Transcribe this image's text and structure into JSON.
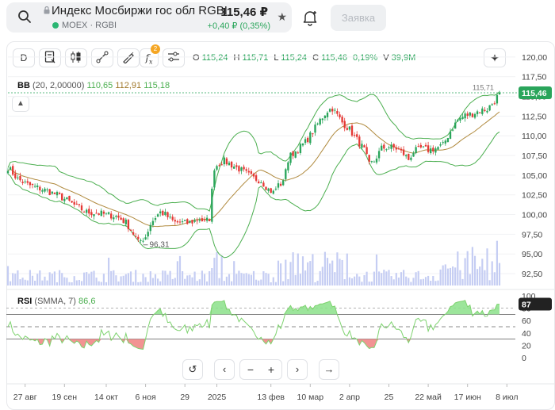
{
  "header": {
    "title": "Индекс Мосбиржи гос обл RGBI",
    "exchange": "MOEX · RGBI",
    "price": "115,46 ₽",
    "change": "+0,40 ₽ (0,35%)"
  },
  "order_button": "Заявка",
  "toolbar": {
    "period": "D",
    "fx_badge": "2"
  },
  "ohlc": {
    "o_label": "O",
    "o": "115,24",
    "h_label": "H",
    "h": "115,71",
    "l_label": "L",
    "l": "115,24",
    "c_label": "C",
    "c": "115,46",
    "pct": "0,19%",
    "v_label": "V",
    "v": "39,9M"
  },
  "bb_indicator": {
    "name": "BB",
    "params": "(20, 2,00000)",
    "lower": "110,65",
    "middle": "112,91",
    "upper": "115,18"
  },
  "rsi_indicator": {
    "name": "RSI",
    "params": "(SMMA, 7)",
    "value": "86,6"
  },
  "annotations": {
    "min_label": "96,31",
    "max_label": "115,71",
    "last_price_tag": "115,46",
    "rsi_tag": "87"
  },
  "colors": {
    "up": "#2aa55b",
    "down": "#e53935",
    "bb_band": "#4caf50",
    "bb_mid": "#b08a3e",
    "volume": "#c5cdf3",
    "rsi": "#7ed36f",
    "rsi_over": "#8be08a",
    "rsi_under": "#f08080",
    "price_tag": "#2aa55b"
  },
  "chart_data": {
    "type": "candlestick",
    "price_axis": {
      "ticks": [
        "120,00",
        "117,50",
        "115,00",
        "112,50",
        "110,00",
        "107,50",
        "105,00",
        "102,50",
        "100,00",
        "97,50",
        "95,00",
        "92,50"
      ],
      "ylim": [
        91.8,
        121.2
      ]
    },
    "rsi_axis": {
      "ticks": [
        "100",
        "80",
        "60",
        "40",
        "20",
        "0"
      ],
      "ylim": [
        0,
        100
      ],
      "levels": [
        30,
        50,
        70,
        80
      ]
    },
    "x_axis_labels": [
      "27 авг",
      "19 сен",
      "14 окт",
      "6 ноя",
      "29",
      "2025",
      "13 фев",
      "10 мар",
      "2 апр",
      "25",
      "22 май",
      "17 июн",
      "8 июл"
    ],
    "x_axis_label_index": [
      7,
      23,
      40,
      56,
      72,
      85,
      107,
      123,
      139,
      155,
      171,
      187,
      203
    ],
    "close_anchors": [
      [
        0,
        106.0
      ],
      [
        4,
        104.5
      ],
      [
        8,
        103.8
      ],
      [
        12,
        103.4
      ],
      [
        16,
        103.0
      ],
      [
        20,
        102.5
      ],
      [
        24,
        101.8
      ],
      [
        28,
        101.0
      ],
      [
        32,
        100.3
      ],
      [
        36,
        100.2
      ],
      [
        40,
        100.0
      ],
      [
        44,
        99.8
      ],
      [
        48,
        99.0
      ],
      [
        51,
        97.6
      ],
      [
        53,
        96.5
      ],
      [
        56,
        97.2
      ],
      [
        58,
        98.8
      ],
      [
        60,
        99.7
      ],
      [
        62,
        100.3
      ],
      [
        64,
        100.0
      ],
      [
        66,
        99.4
      ],
      [
        68,
        99.0
      ],
      [
        70,
        99.0
      ],
      [
        73,
        98.9
      ],
      [
        76,
        99.2
      ],
      [
        78,
        99.5
      ],
      [
        80,
        99.0
      ],
      [
        82,
        99.5
      ],
      [
        83,
        103.0
      ],
      [
        84,
        106.0
      ],
      [
        86,
        106.5
      ],
      [
        88,
        106.8
      ],
      [
        91,
        106.3
      ],
      [
        94,
        105.8
      ],
      [
        97,
        105.2
      ],
      [
        100,
        104.6
      ],
      [
        103,
        104.3
      ],
      [
        106,
        103.2
      ],
      [
        108,
        102.8
      ],
      [
        110,
        103.8
      ],
      [
        112,
        104.0
      ],
      [
        113,
        106.0
      ],
      [
        115,
        107.5
      ],
      [
        118,
        108.3
      ],
      [
        121,
        109.2
      ],
      [
        124,
        110.5
      ],
      [
        127,
        112.0
      ],
      [
        130,
        113.2
      ],
      [
        132,
        113.5
      ],
      [
        134,
        112.6
      ],
      [
        136,
        111.7
      ],
      [
        139,
        110.8
      ],
      [
        142,
        109.5
      ],
      [
        145,
        108.2
      ],
      [
        147,
        106.3
      ],
      [
        149,
        106.8
      ],
      [
        152,
        108.4
      ],
      [
        155,
        108.6
      ],
      [
        158,
        108.4
      ],
      [
        161,
        107.7
      ],
      [
        163,
        107.0
      ],
      [
        165,
        108.0
      ],
      [
        168,
        108.4
      ],
      [
        171,
        108.2
      ],
      [
        174,
        108.4
      ],
      [
        177,
        108.8
      ],
      [
        180,
        110.6
      ],
      [
        183,
        112.0
      ],
      [
        186,
        112.6
      ],
      [
        189,
        112.8
      ],
      [
        192,
        113.2
      ],
      [
        195,
        113.4
      ],
      [
        198,
        114.4
      ],
      [
        200,
        115.46
      ]
    ],
    "ohlc_last": {
      "open": 115.24,
      "high": 115.71,
      "low": 115.24,
      "close": 115.46,
      "change_pct": 0.19,
      "volume": "39,9M"
    },
    "bb_last": {
      "lower": 110.65,
      "middle": 112.91,
      "upper": 115.18
    },
    "rsi_last": 86.6
  }
}
